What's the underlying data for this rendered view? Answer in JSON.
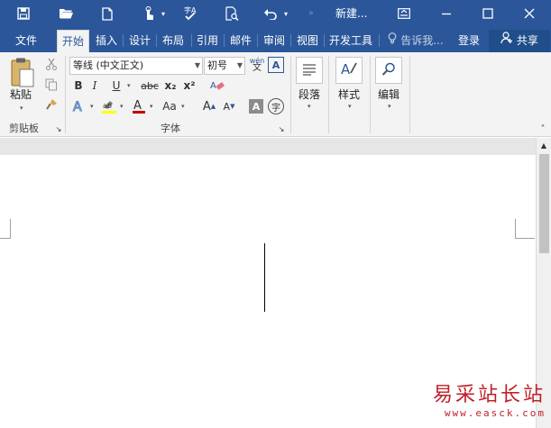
{
  "titlebar": {
    "title": "新建...",
    "save_icon": "save-icon",
    "open_icon": "folder-open-icon",
    "new_icon": "new-document-icon",
    "touch_icon": "touch-mode-icon",
    "spelling_icon": "spelling-check-icon",
    "print_preview_icon": "print-preview-icon",
    "undo_icon": "undo-icon",
    "ribbon_display_icon": "ribbon-display-options-icon",
    "minimize_icon": "minimize-icon",
    "maximize_icon": "maximize-icon",
    "close_icon": "close-icon"
  },
  "tabs": [
    {
      "label": "文件"
    },
    {
      "label": "开始"
    },
    {
      "label": "插入"
    },
    {
      "label": "设计"
    },
    {
      "label": "布局"
    },
    {
      "label": "引用"
    },
    {
      "label": "邮件"
    },
    {
      "label": "审阅"
    },
    {
      "label": "视图"
    },
    {
      "label": "开发工具"
    }
  ],
  "tellme": {
    "label": "告诉我..."
  },
  "login": {
    "label": "登录"
  },
  "share": {
    "label": "共享"
  },
  "clipboard": {
    "paste_label": "粘贴",
    "group_label": "剪贴板"
  },
  "font": {
    "font_name": "等线 (中文正文)",
    "font_size": "初号",
    "phonetic_label": "wén",
    "group_label": "字体",
    "bold": "B",
    "italic": "I",
    "underline": "U",
    "strikethrough": "abc",
    "subscript": "x₂",
    "superscript": "x²",
    "change_case": "Aa",
    "grow_font": "A",
    "shrink_font": "A",
    "char_border": "A",
    "char_shade": "A",
    "enclose_char": "字",
    "highlight_color": "#ffff00",
    "font_color": "#c00000",
    "text_effect_color": "#4f81bd"
  },
  "paragraph": {
    "label": "段落"
  },
  "styles": {
    "label": "样式"
  },
  "editing": {
    "label": "编辑"
  },
  "watermark": {
    "text": "易采站长站",
    "url": "www.easck.com"
  }
}
